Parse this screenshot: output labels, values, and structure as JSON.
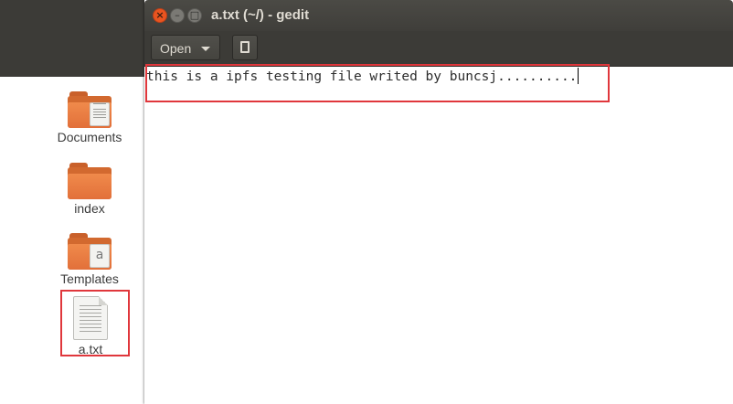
{
  "desktop": {
    "icons": [
      {
        "label": "Documents",
        "icon": "folder-documents-icon"
      },
      {
        "label": "index",
        "icon": "folder-icon"
      },
      {
        "label": "Templates",
        "icon": "folder-templates-icon"
      },
      {
        "label": "a.txt",
        "icon": "text-file-icon"
      }
    ]
  },
  "window": {
    "title": "a.txt (~/) - gedit",
    "controls": {
      "close": "×",
      "minimize": "–",
      "maximize": "□"
    }
  },
  "headerbar": {
    "open_label": "Open",
    "new_tab_icon": "new-tab-icon"
  },
  "editor": {
    "text": "this is a ipfs testing file writed by buncsj.........."
  },
  "colors": {
    "highlight": "#e0373c",
    "titlebar": "#3f3e3a",
    "close_button": "#e95420"
  }
}
